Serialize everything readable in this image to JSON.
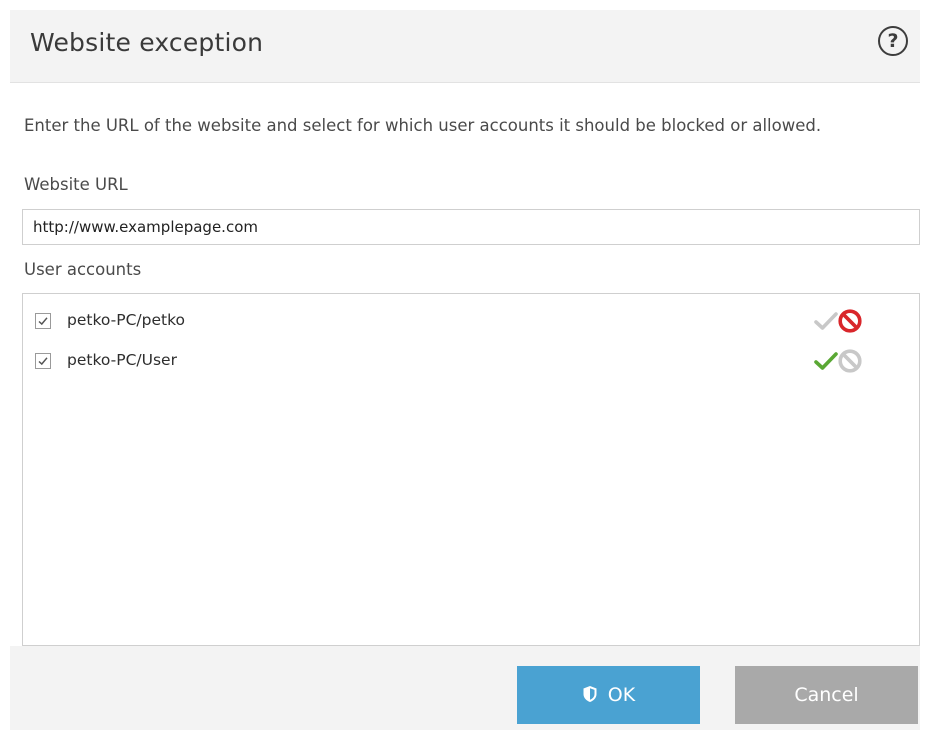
{
  "dialog": {
    "title": "Website exception",
    "help_icon": "question-circle-icon",
    "help_glyph": "?"
  },
  "description": "Enter the URL of the website and select for which user accounts it should be blocked or allowed.",
  "website_url": {
    "label": "Website URL",
    "value": "http://www.examplepage.com"
  },
  "user_accounts": {
    "label": "User accounts",
    "items": [
      {
        "name": "petko-PC/petko",
        "checked": true,
        "state": "blocked"
      },
      {
        "name": "petko-PC/User",
        "checked": true,
        "state": "allowed"
      }
    ]
  },
  "buttons": {
    "ok_label": "OK",
    "ok_icon": "shield-icon",
    "cancel_label": "Cancel"
  },
  "colors": {
    "ok_button": "#4aa2d2",
    "cancel_button": "#a9a9a9",
    "allow_active": "#5aa834",
    "block_active": "#d9262b",
    "inactive": "#c8c8c8"
  }
}
